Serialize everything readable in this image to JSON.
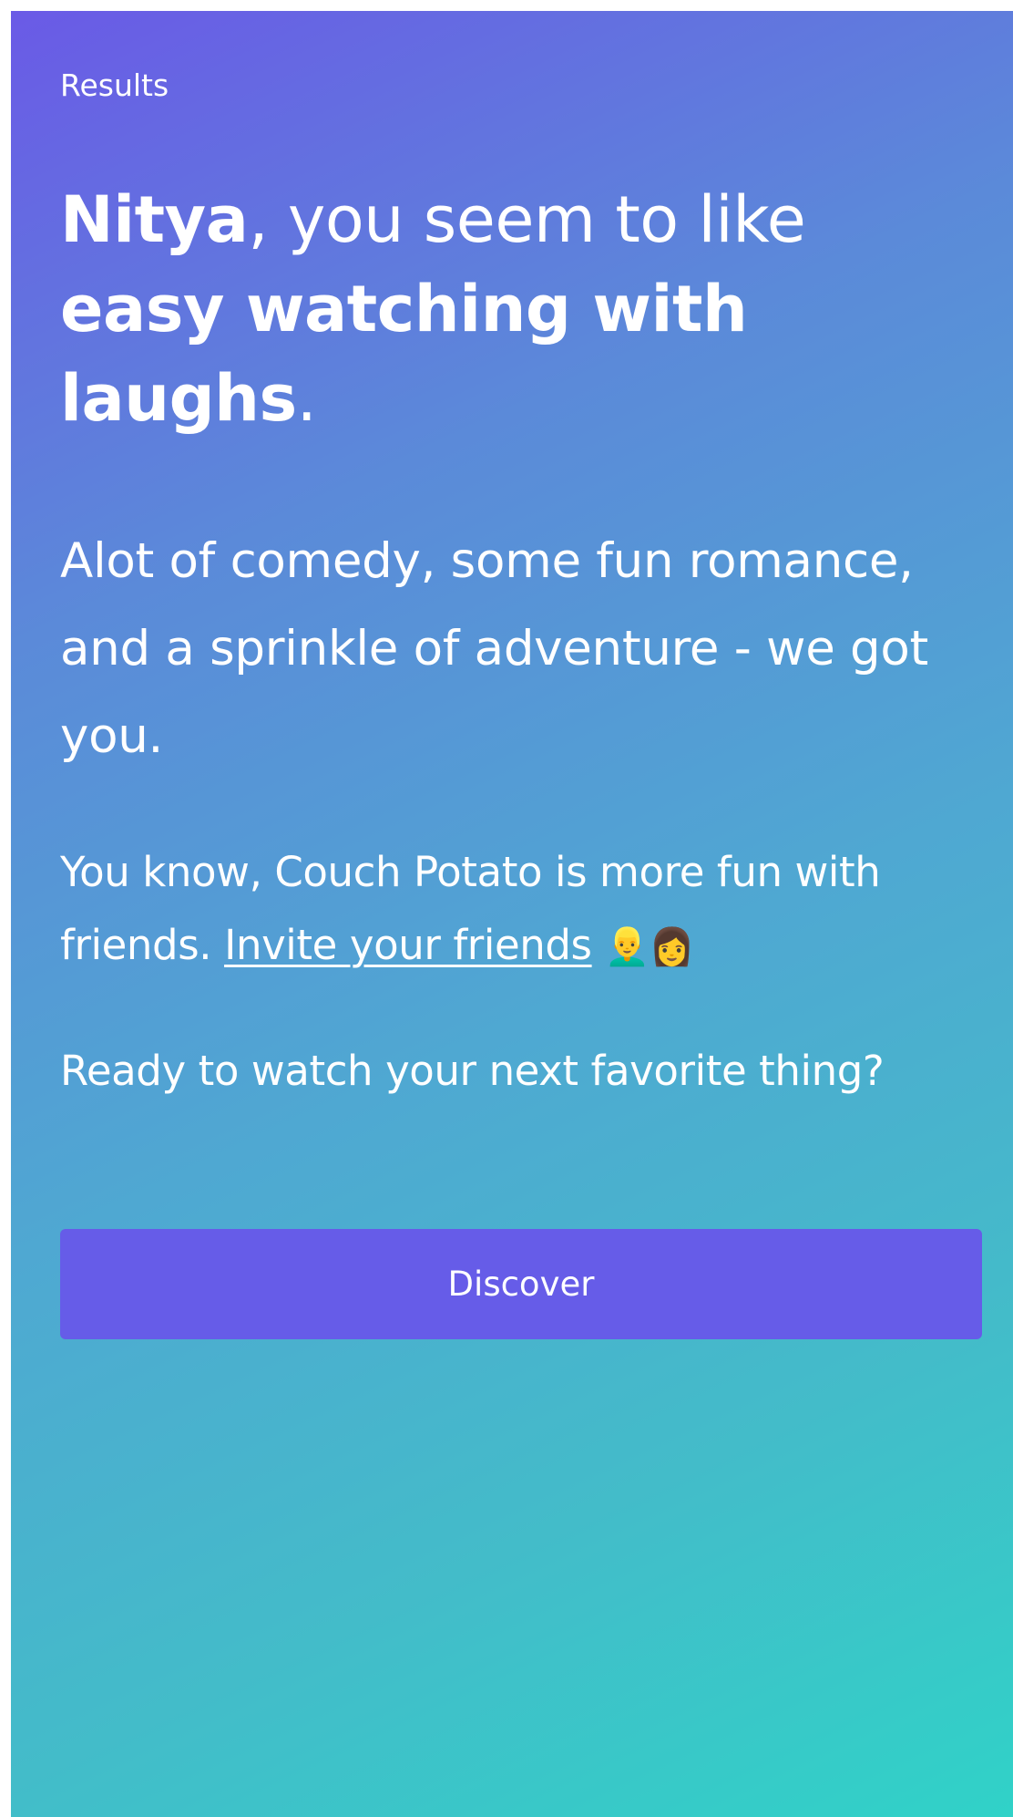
{
  "header": {
    "eyebrow": "Results"
  },
  "headline": {
    "name": "Nitya",
    "middle": ", you seem to like ",
    "preference": "easy watching with laughs",
    "end": "."
  },
  "lead": {
    "text": "Alot of comedy, some fun romance, and a sprinkle of adventure - we got you."
  },
  "invite": {
    "text": "You know, Couch Potato is more fun with friends. ",
    "link_label": "Invite your friends",
    "emoji": "👱‍♂️👩"
  },
  "prompt": {
    "text": "Ready to watch your next favorite thing?"
  },
  "actions": {
    "discover_label": "Discover"
  },
  "colors": {
    "gradient_start": "#6a5ae6",
    "gradient_end": "#30d2c8",
    "button_background": "#665ce8",
    "text": "#ffffff"
  }
}
